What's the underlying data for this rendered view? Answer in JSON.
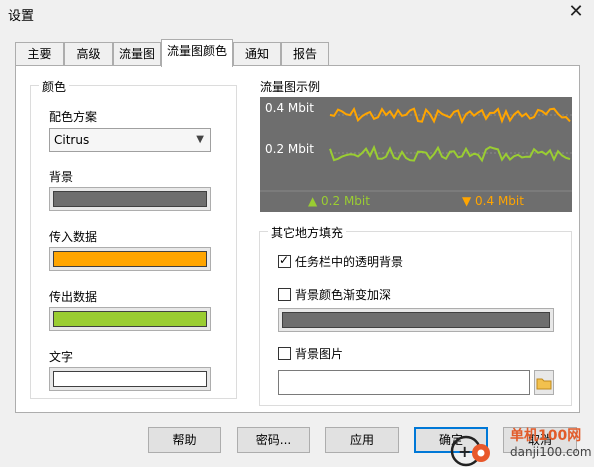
{
  "window": {
    "title": "设置"
  },
  "tabs": [
    "主要",
    "高级",
    "流量图",
    "流量图颜色",
    "通知",
    "报告"
  ],
  "active_tab": "流量图颜色",
  "colors_group": {
    "title": "颜色",
    "scheme_label": "配色方案",
    "scheme_value": "Citrus",
    "background_label": "背景",
    "incoming_label": "传入数据",
    "outgoing_label": "传出数据",
    "text_label": "文字"
  },
  "swatch_colors": {
    "background": "#6e6e6e",
    "incoming": "#ffa500",
    "outgoing": "#9acd32",
    "text": "#ffffff"
  },
  "preview": {
    "title": "流量图示例",
    "label_top": "0.4 Mbit",
    "label_mid": "0.2 Mbit",
    "legend_in": "▲ 0.2 Mbit",
    "legend_out": "▼ 0.4 Mbit"
  },
  "fill_group": {
    "title": "其它地方填充",
    "transparent_label": "任务栏中的透明背景",
    "transparent_checked": true,
    "gradient_label": "背景颜色渐变加深",
    "gradient_checked": false,
    "image_label": "背景图片",
    "image_checked": false,
    "image_path": ""
  },
  "buttons": {
    "help": "帮助",
    "password": "密码...",
    "apply": "应用",
    "ok": "确定",
    "cancel": "取消"
  },
  "watermark": {
    "brand": "单机100网",
    "domain": "danji100.com"
  }
}
